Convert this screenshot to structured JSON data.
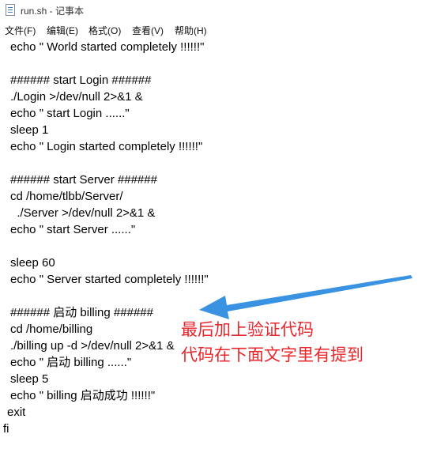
{
  "window": {
    "title": "run.sh - 记事本",
    "icon": "notepad-icon"
  },
  "menu": [
    {
      "label": "文件(F)"
    },
    {
      "label": "编辑(E)"
    },
    {
      "label": "格式(O)"
    },
    {
      "label": "查看(V)"
    },
    {
      "label": "帮助(H)"
    }
  ],
  "editor": {
    "lines": [
      "echo \" World started completely !!!!!!\"",
      "",
      "###### start Login ######",
      "./Login >/dev/null 2>&1 &",
      "echo \" start Login ......\"",
      "sleep 1",
      "echo \" Login started completely !!!!!!\"",
      "",
      "###### start Server ######",
      "cd /home/tlbb/Server/",
      "  ./Server >/dev/null 2>&1 &",
      "echo \" start Server ......\"",
      "",
      "sleep 60",
      "echo \" Server started completely !!!!!!\"",
      "",
      "###### 启动 billing ######",
      "cd /home/billing",
      "./billing up -d >/dev/null 2>&1 &",
      "echo \" 启动 billing ......\"",
      "sleep 5",
      "echo \" billing 启动成功 !!!!!!\"",
      "exit",
      "fi"
    ]
  },
  "annotation": {
    "line1": "最后加上验证代码",
    "line2": "代码在下面文字里有提到",
    "color": "#e8262c",
    "arrow_color": "#2f8de0"
  }
}
